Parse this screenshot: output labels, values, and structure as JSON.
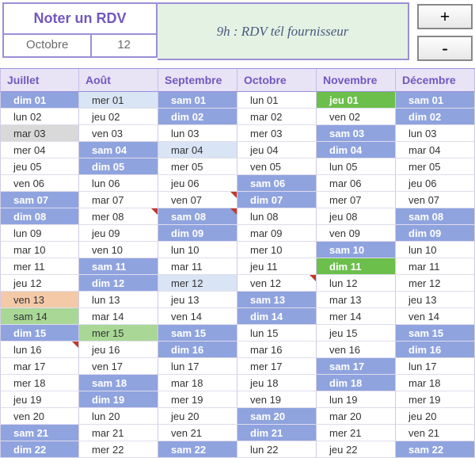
{
  "top": {
    "title": "Noter un RDV",
    "month": "Octobre",
    "day": "12",
    "appointment": "9h : RDV tél fournisseur",
    "plus": "+",
    "minus": "-"
  },
  "months": [
    "Juillet",
    "Août",
    "Septembre",
    "Octobre",
    "Novembre",
    "Décembre"
  ],
  "cols": [
    [
      {
        "t": "dim 01",
        "c": "weekend-light"
      },
      {
        "t": "lun 02"
      },
      {
        "t": "mar 03",
        "c": "gray"
      },
      {
        "t": "mer 04"
      },
      {
        "t": "jeu 05"
      },
      {
        "t": "ven 06"
      },
      {
        "t": "sam 07",
        "c": "weekend-light"
      },
      {
        "t": "dim 08",
        "c": "weekend-light"
      },
      {
        "t": "lun 09"
      },
      {
        "t": "mar 10"
      },
      {
        "t": "mer 11"
      },
      {
        "t": "jeu 12"
      },
      {
        "t": "ven 13",
        "c": "orange"
      },
      {
        "t": "sam 14",
        "c": "green-light"
      },
      {
        "t": "dim 15",
        "c": "weekend-light"
      },
      {
        "t": "lun 16",
        "tri": true
      },
      {
        "t": "mar 17"
      },
      {
        "t": "mer 18"
      },
      {
        "t": "jeu 19"
      },
      {
        "t": "ven 20"
      },
      {
        "t": "sam 21",
        "c": "weekend-light"
      },
      {
        "t": "dim 22",
        "c": "weekend-light"
      }
    ],
    [
      {
        "t": "mer 01",
        "c": "pale-blue"
      },
      {
        "t": "jeu 02"
      },
      {
        "t": "ven 03"
      },
      {
        "t": "sam 04",
        "c": "weekend-light"
      },
      {
        "t": "dim 05",
        "c": "weekend-light"
      },
      {
        "t": "lun 06"
      },
      {
        "t": "mar 07"
      },
      {
        "t": "mer 08",
        "tri": true
      },
      {
        "t": "jeu 09"
      },
      {
        "t": "ven 10"
      },
      {
        "t": "sam 11",
        "c": "weekend-light"
      },
      {
        "t": "dim 12",
        "c": "weekend-light"
      },
      {
        "t": "lun 13"
      },
      {
        "t": "mar 14"
      },
      {
        "t": "mer 15",
        "c": "green-light"
      },
      {
        "t": "jeu 16"
      },
      {
        "t": "ven 17"
      },
      {
        "t": "sam 18",
        "c": "weekend-light"
      },
      {
        "t": "dim 19",
        "c": "weekend-light"
      },
      {
        "t": "lun 20"
      },
      {
        "t": "mar 21"
      },
      {
        "t": "mer 22"
      }
    ],
    [
      {
        "t": "sam 01",
        "c": "weekend-light"
      },
      {
        "t": "dim 02",
        "c": "weekend-light"
      },
      {
        "t": "lun 03"
      },
      {
        "t": "mar 04",
        "c": "pale-blue"
      },
      {
        "t": "mer 05"
      },
      {
        "t": "jeu 06"
      },
      {
        "t": "ven 07",
        "tri": true
      },
      {
        "t": "sam 08",
        "c": "weekend-light",
        "tri": true
      },
      {
        "t": "dim 09",
        "c": "weekend-light"
      },
      {
        "t": "lun 10"
      },
      {
        "t": "mar 11"
      },
      {
        "t": "mer 12",
        "c": "pale-blue"
      },
      {
        "t": "jeu 13"
      },
      {
        "t": "ven 14"
      },
      {
        "t": "sam 15",
        "c": "weekend-light"
      },
      {
        "t": "dim 16",
        "c": "weekend-light"
      },
      {
        "t": "lun 17"
      },
      {
        "t": "mar 18"
      },
      {
        "t": "mer 19"
      },
      {
        "t": "jeu 20"
      },
      {
        "t": "ven 21"
      },
      {
        "t": "sam 22",
        "c": "weekend-light"
      }
    ],
    [
      {
        "t": "lun 01"
      },
      {
        "t": "mar 02"
      },
      {
        "t": "mer 03"
      },
      {
        "t": "jeu 04"
      },
      {
        "t": "ven 05"
      },
      {
        "t": "sam 06",
        "c": "weekend-light"
      },
      {
        "t": "dim 07",
        "c": "weekend-light"
      },
      {
        "t": "lun 08"
      },
      {
        "t": "mar 09"
      },
      {
        "t": "mer 10"
      },
      {
        "t": "jeu 11"
      },
      {
        "t": "ven 12",
        "tri": true
      },
      {
        "t": "sam 13",
        "c": "weekend-light"
      },
      {
        "t": "dim 14",
        "c": "weekend-light"
      },
      {
        "t": "lun 15"
      },
      {
        "t": "mar 16"
      },
      {
        "t": "mer 17"
      },
      {
        "t": "jeu 18"
      },
      {
        "t": "ven 19"
      },
      {
        "t": "sam 20",
        "c": "weekend-light"
      },
      {
        "t": "dim 21",
        "c": "weekend-light"
      },
      {
        "t": "lun 22"
      }
    ],
    [
      {
        "t": "jeu 01",
        "c": "green-strong"
      },
      {
        "t": "ven 02"
      },
      {
        "t": "sam 03",
        "c": "weekend-light"
      },
      {
        "t": "dim 04",
        "c": "weekend-light"
      },
      {
        "t": "lun 05"
      },
      {
        "t": "mar 06"
      },
      {
        "t": "mer 07"
      },
      {
        "t": "jeu 08"
      },
      {
        "t": "ven 09"
      },
      {
        "t": "sam 10",
        "c": "weekend-light"
      },
      {
        "t": "dim 11",
        "c": "green-strong"
      },
      {
        "t": "lun 12"
      },
      {
        "t": "mar 13"
      },
      {
        "t": "mer 14"
      },
      {
        "t": "jeu 15"
      },
      {
        "t": "ven 16"
      },
      {
        "t": "sam 17",
        "c": "weekend-light"
      },
      {
        "t": "dim 18",
        "c": "weekend-light"
      },
      {
        "t": "lun 19"
      },
      {
        "t": "mar 20"
      },
      {
        "t": "mer 21"
      },
      {
        "t": "jeu 22"
      }
    ],
    [
      {
        "t": "sam 01",
        "c": "weekend-light"
      },
      {
        "t": "dim 02",
        "c": "weekend-light"
      },
      {
        "t": "lun 03"
      },
      {
        "t": "mar 04"
      },
      {
        "t": "mer 05"
      },
      {
        "t": "jeu 06"
      },
      {
        "t": "ven 07"
      },
      {
        "t": "sam 08",
        "c": "weekend-light"
      },
      {
        "t": "dim 09",
        "c": "weekend-light"
      },
      {
        "t": "lun 10"
      },
      {
        "t": "mar 11"
      },
      {
        "t": "mer 12"
      },
      {
        "t": "jeu 13"
      },
      {
        "t": "ven 14"
      },
      {
        "t": "sam 15",
        "c": "weekend-light"
      },
      {
        "t": "dim 16",
        "c": "weekend-light"
      },
      {
        "t": "lun 17"
      },
      {
        "t": "mar 18"
      },
      {
        "t": "mer 19"
      },
      {
        "t": "jeu 20"
      },
      {
        "t": "ven 21"
      },
      {
        "t": "sam 22",
        "c": "weekend-light"
      }
    ]
  ]
}
